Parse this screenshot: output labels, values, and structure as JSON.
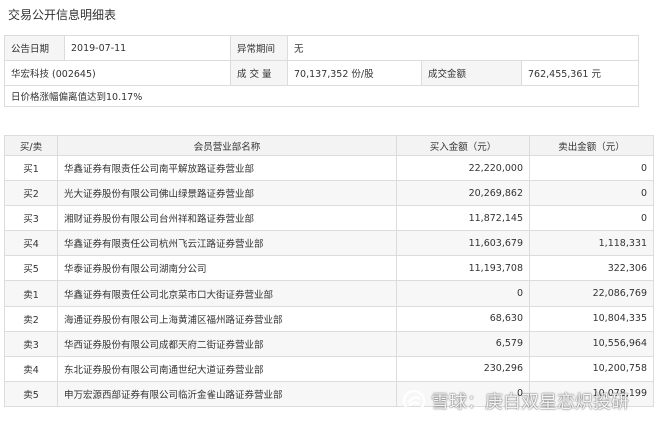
{
  "page_title": "交易公开信息明细表",
  "info": {
    "date_label": "公告日期",
    "date_value": "2019-07-11",
    "period_label": "异常期间",
    "period_value": "无",
    "stock": "华宏科技 (002645)",
    "volume_label": "成 交 量",
    "volume_value": "70,137,352 份/股",
    "amount_label": "成交金额",
    "amount_value": "762,455,361 元",
    "deviation": "日价格涨幅偏离值达到10.17%"
  },
  "table": {
    "headers": [
      "买/卖",
      "会员营业部名称",
      "买入金额（元）",
      "卖出金额（元）"
    ],
    "rows": [
      {
        "dir": "买1",
        "name": "华鑫证券有限责任公司南平解放路证券营业部",
        "buy": "22,220,000",
        "sell": "0"
      },
      {
        "dir": "买2",
        "name": "光大证券股份有限公司佛山绿景路证券营业部",
        "buy": "20,269,862",
        "sell": "0"
      },
      {
        "dir": "买3",
        "name": "湘财证券股份有限公司台州祥和路证券营业部",
        "buy": "11,872,145",
        "sell": "0"
      },
      {
        "dir": "买4",
        "name": "华鑫证券有限责任公司杭州飞云江路证券营业部",
        "buy": "11,603,679",
        "sell": "1,118,331"
      },
      {
        "dir": "买5",
        "name": "华泰证券股份有限公司湖南分公司",
        "buy": "11,193,708",
        "sell": "322,306"
      },
      {
        "dir": "卖1",
        "name": "华鑫证券有限责任公司北京菜市口大街证券营业部",
        "buy": "0",
        "sell": "22,086,769"
      },
      {
        "dir": "卖2",
        "name": "海通证券股份有限公司上海黄浦区福州路证券营业部",
        "buy": "68,630",
        "sell": "10,804,335"
      },
      {
        "dir": "卖3",
        "name": "华西证券股份有限公司成都天府二街证券营业部",
        "buy": "6,579",
        "sell": "10,556,964"
      },
      {
        "dir": "卖4",
        "name": "东北证券股份有限公司南通世纪大道证券营业部",
        "buy": "230,296",
        "sell": "10,200,758"
      },
      {
        "dir": "卖5",
        "name": "申万宏源西部证券有限公司临沂金雀山路证券营业部",
        "buy": "0",
        "sell": "10,078,199"
      }
    ]
  },
  "watermark": {
    "text": "雪球：庚白双星恋炽投研",
    "logo_icon": "snowball-logo-icon"
  }
}
